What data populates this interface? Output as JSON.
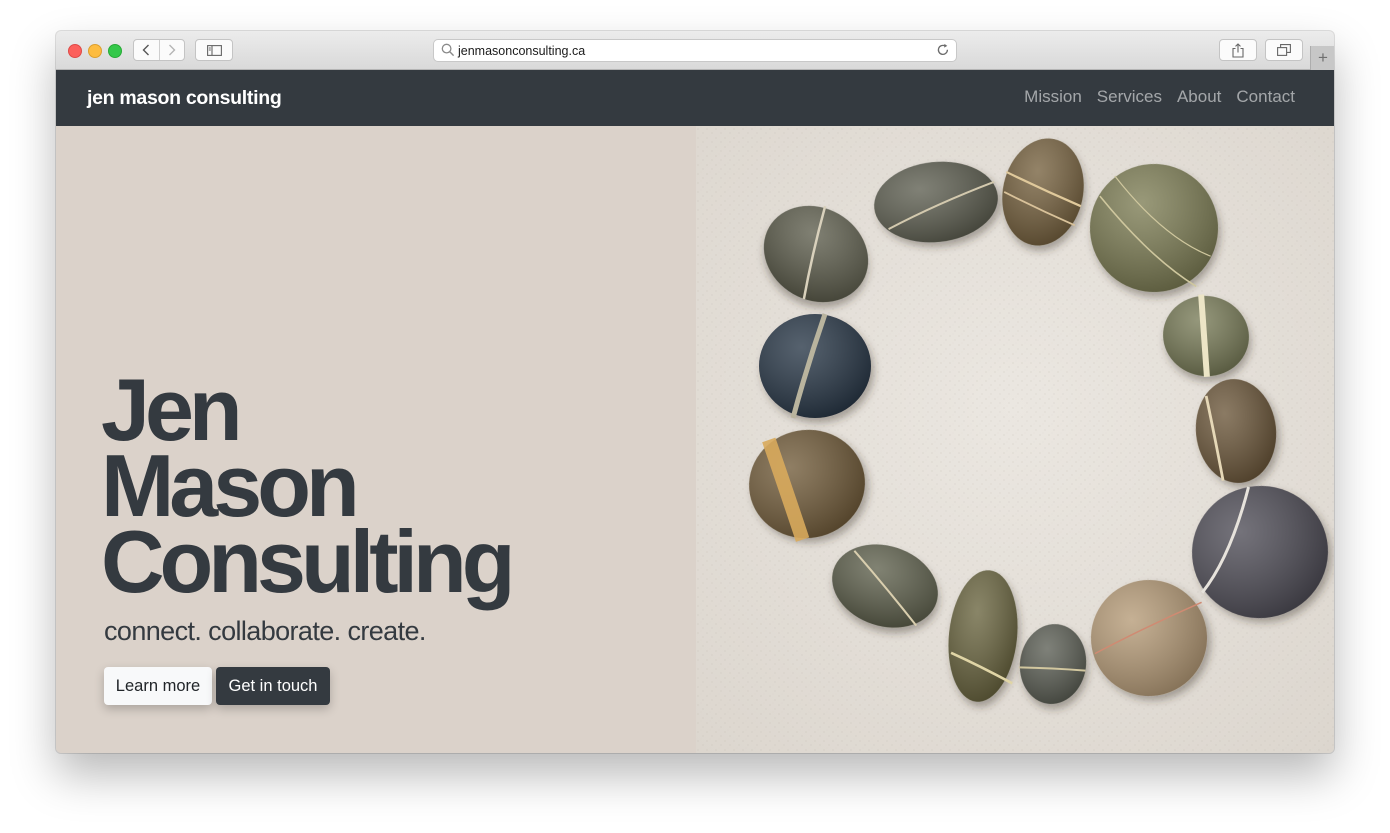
{
  "browser": {
    "url": "jenmasonconsulting.ca"
  },
  "navbar": {
    "brand": "jen mason consulting",
    "links": [
      "Mission",
      "Services",
      "About",
      "Contact"
    ]
  },
  "hero": {
    "title_lines": [
      "Jen",
      "Mason",
      "Consulting"
    ],
    "tagline": "connect. collaborate. create.",
    "buttons": {
      "learn_more": "Learn more",
      "get_in_touch": "Get in touch"
    },
    "image": "circle of striped pebbles on sand"
  },
  "colors": {
    "navbar_bg": "#343a40",
    "hero_bg": "#dbd2ca",
    "text_dark": "#343a40",
    "sand": "#e6e1da"
  }
}
